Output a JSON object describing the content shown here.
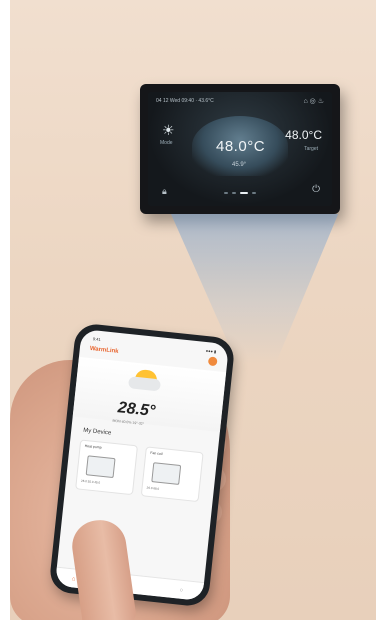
{
  "panel": {
    "status_text": "04 12  Wed  09:40  ·  43.6°C",
    "status_icons": "⌂ ◎ ♨",
    "sun_icon": "sun-icon",
    "mode_label": "Mode",
    "main_temp": "48.0°C",
    "right_temp": "48.0°C",
    "target_label": "Target",
    "small_temp": "45.9°",
    "lock_icon": "lock-icon",
    "power_icon": "power-icon"
  },
  "phone": {
    "status_time": "9:41",
    "status_right": "●●● ▮",
    "app_name": "WarmLink",
    "weather_temp": "28.5°",
    "weather_sub": "MON   40.0%   19°-32°",
    "section_title": "My Device",
    "cards": [
      {
        "title": "Heat pump",
        "value": "25.0  35.0  45.0"
      },
      {
        "title": "Fan coil",
        "value": "26.0  68.0"
      }
    ],
    "home_icon": "home-icon",
    "user_icon": "user-icon"
  },
  "colors": {
    "wall": "#ecd6c2",
    "accent": "#e8632c",
    "panel_bezel": "#151619",
    "beam": "#8fb3d8"
  }
}
